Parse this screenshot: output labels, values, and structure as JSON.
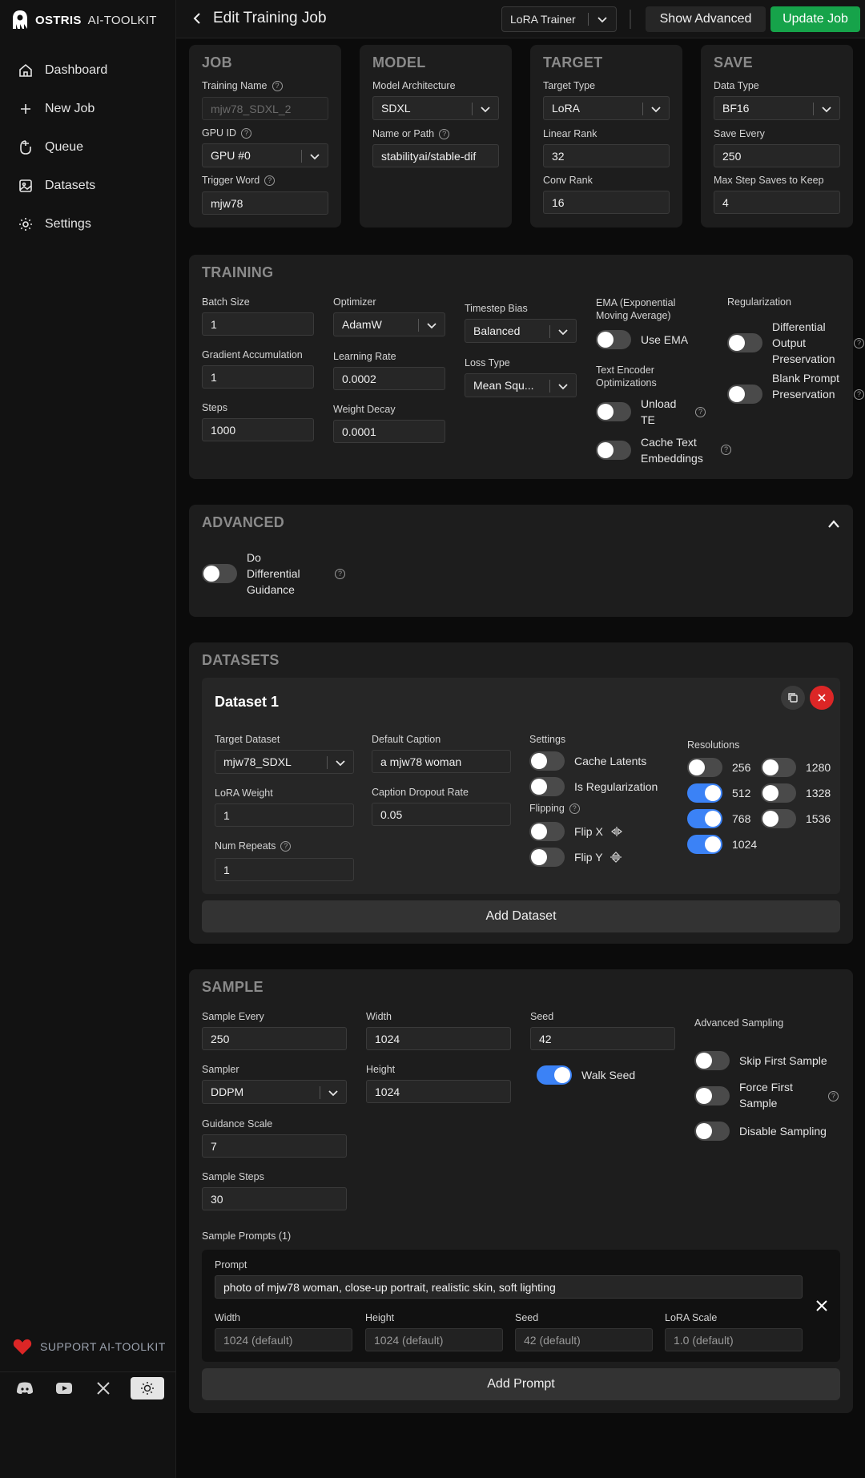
{
  "app": {
    "brand_bold": "OSTRIS",
    "brand_light": "AI-TOOLKIT"
  },
  "sidebar": {
    "items": [
      {
        "label": "Dashboard",
        "icon": "home-icon"
      },
      {
        "label": "New Job",
        "icon": "plus-icon"
      },
      {
        "label": "Queue",
        "icon": "queue-icon"
      },
      {
        "label": "Datasets",
        "icon": "image-icon"
      },
      {
        "label": "Settings",
        "icon": "gear-icon"
      }
    ],
    "support": "SUPPORT AI-TOOLKIT",
    "social": [
      "discord-icon",
      "youtube-icon",
      "x-icon",
      "sun-icon"
    ]
  },
  "topbar": {
    "title": "Edit Training Job",
    "job_type": "LoRA Trainer",
    "show_advanced": "Show Advanced",
    "update": "Update Job"
  },
  "job": {
    "title": "JOB",
    "training_name_label": "Training Name",
    "training_name": "mjw78_SDXL_2",
    "gpu_label": "GPU ID",
    "gpu": "GPU #0",
    "trigger_label": "Trigger Word",
    "trigger": "mjw78"
  },
  "model": {
    "title": "MODEL",
    "arch_label": "Model Architecture",
    "arch": "SDXL",
    "path_label": "Name or Path",
    "path": "stabilityai/stable-dif"
  },
  "target": {
    "title": "TARGET",
    "type_label": "Target Type",
    "type": "LoRA",
    "linear_label": "Linear Rank",
    "linear": "32",
    "conv_label": "Conv Rank",
    "conv": "16"
  },
  "save": {
    "title": "SAVE",
    "dtype_label": "Data Type",
    "dtype": "BF16",
    "every_label": "Save Every",
    "every": "250",
    "max_label": "Max Step Saves to Keep",
    "max": "4"
  },
  "training": {
    "title": "TRAINING",
    "batch_label": "Batch Size",
    "batch": "1",
    "grad_label": "Gradient Accumulation",
    "grad": "1",
    "steps_label": "Steps",
    "steps": "1000",
    "optimizer_label": "Optimizer",
    "optimizer": "AdamW",
    "lr_label": "Learning Rate",
    "lr": "0.0002",
    "wd_label": "Weight Decay",
    "wd": "0.0001",
    "timestep_label": "Timestep Bias",
    "timestep": "Balanced",
    "loss_label": "Loss Type",
    "loss": "Mean Squ...",
    "ema_label": "EMA (Exponential Moving Average)",
    "use_ema": "Use EMA",
    "te_label": "Text Encoder Optimizations",
    "unload_te": "Unload TE",
    "cache_te": "Cache Text Embeddings",
    "reg_label": "Regularization",
    "diff_output": "Differential Output Preservation",
    "blank_prompt": "Blank Prompt Preservation"
  },
  "advanced": {
    "title": "ADVANCED",
    "diff_guidance": "Do Differential Guidance"
  },
  "datasets": {
    "title": "DATASETS",
    "dataset_title": "Dataset 1",
    "target_label": "Target Dataset",
    "target": "mjw78_SDXL",
    "lora_weight_label": "LoRA Weight",
    "lora_weight": "1",
    "repeats_label": "Num Repeats",
    "repeats": "1",
    "caption_label": "Default Caption",
    "caption": "a mjw78 woman",
    "dropout_label": "Caption Dropout Rate",
    "dropout": "0.05",
    "settings_label": "Settings",
    "cache_latents": "Cache Latents",
    "is_reg": "Is Regularization",
    "flipping_label": "Flipping",
    "flip_x": "Flip X",
    "flip_y": "Flip Y",
    "resolutions_label": "Resolutions",
    "res": [
      {
        "label": "256",
        "on": false
      },
      {
        "label": "512",
        "on": true
      },
      {
        "label": "768",
        "on": true
      },
      {
        "label": "1024",
        "on": true
      },
      {
        "label": "1280",
        "on": false
      },
      {
        "label": "1328",
        "on": false
      },
      {
        "label": "1536",
        "on": false
      }
    ],
    "add": "Add Dataset"
  },
  "sample": {
    "title": "SAMPLE",
    "every_label": "Sample Every",
    "every": "250",
    "sampler_label": "Sampler",
    "sampler": "DDPM",
    "guidance_label": "Guidance Scale",
    "guidance": "7",
    "steps_label": "Sample Steps",
    "steps": "30",
    "width_label": "Width",
    "width": "1024",
    "height_label": "Height",
    "height": "1024",
    "seed_label": "Seed",
    "seed": "42",
    "walk_seed": "Walk Seed",
    "adv_label": "Advanced Sampling",
    "skip_first": "Skip First Sample",
    "force_first": "Force First Sample",
    "disable": "Disable Sampling",
    "prompts_label": "Sample Prompts (1)",
    "prompt_label": "Prompt",
    "prompt": "photo of mjw78 woman, close-up portrait, realistic skin, soft lighting",
    "p_width_label": "Width",
    "p_width": "1024 (default)",
    "p_height_label": "Height",
    "p_height": "1024 (default)",
    "p_seed_label": "Seed",
    "p_seed": "42 (default)",
    "p_scale_label": "LoRA Scale",
    "p_scale": "1.0 (default)",
    "add": "Add Prompt"
  }
}
